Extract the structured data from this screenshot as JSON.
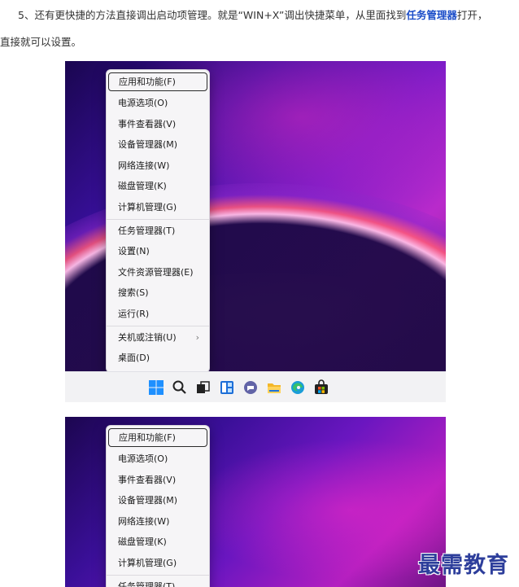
{
  "article": {
    "line1_prefix": "5、还有更快捷的方法直接调出启动项管理。就是“WIN+X”调出快捷菜单，从里面找到",
    "line1_link": "任务管理器",
    "line1_suffix": "打开，",
    "line2": "直接就可以设置。"
  },
  "menu1": {
    "items": [
      {
        "label": "应用和功能(F)"
      },
      {
        "label": "电源选项(O)"
      },
      {
        "label": "事件查看器(V)"
      },
      {
        "label": "设备管理器(M)"
      },
      {
        "label": "网络连接(W)"
      },
      {
        "label": "磁盘管理(K)"
      },
      {
        "label": "计算机管理(G)"
      },
      {
        "label": "任务管理器(T)"
      },
      {
        "label": "设置(N)"
      },
      {
        "label": "文件资源管理器(E)"
      },
      {
        "label": "搜索(S)"
      },
      {
        "label": "运行(R)"
      },
      {
        "label": "关机或注销(U)",
        "chevron": "›"
      },
      {
        "label": "桌面(D)"
      }
    ]
  },
  "menu2": {
    "items": [
      {
        "label": "应用和功能(F)"
      },
      {
        "label": "电源选项(O)"
      },
      {
        "label": "事件查看器(V)"
      },
      {
        "label": "设备管理器(M)"
      },
      {
        "label": "网络连接(W)"
      },
      {
        "label": "磁盘管理(K)"
      },
      {
        "label": "计算机管理(G)"
      },
      {
        "label": "任务管理器(T)"
      }
    ]
  },
  "taskbar": {
    "icons": [
      "windows-start-icon",
      "search-icon",
      "task-view-icon",
      "widgets-icon",
      "teams-chat-icon",
      "file-explorer-icon",
      "edge-browser-icon",
      "store-icon"
    ]
  },
  "watermark": {
    "text": "最需教育"
  },
  "colors": {
    "link": "#1a4cc8",
    "watermark": "#2d3e9b",
    "menu_bg": "#f6f5f7"
  }
}
